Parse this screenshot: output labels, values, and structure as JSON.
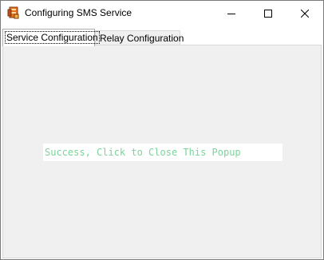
{
  "window": {
    "title": "Configuring SMS Service",
    "icon": "sms-service-app-icon"
  },
  "titlebar_buttons": {
    "minimize": "minimize-icon",
    "maximize": "maximize-icon",
    "close": "close-icon"
  },
  "tabs": [
    {
      "label": "Service Configuration",
      "selected": true
    },
    {
      "label": "Relay Configuration",
      "selected": false
    }
  ],
  "panel": {
    "status_message": "Success, Click to Close This Popup",
    "status_color": "#7bd39b"
  },
  "colors": {
    "panel_background": "#f0f0f0",
    "app_icon_primary": "#e8731c",
    "app_icon_dark": "#b5501a"
  }
}
